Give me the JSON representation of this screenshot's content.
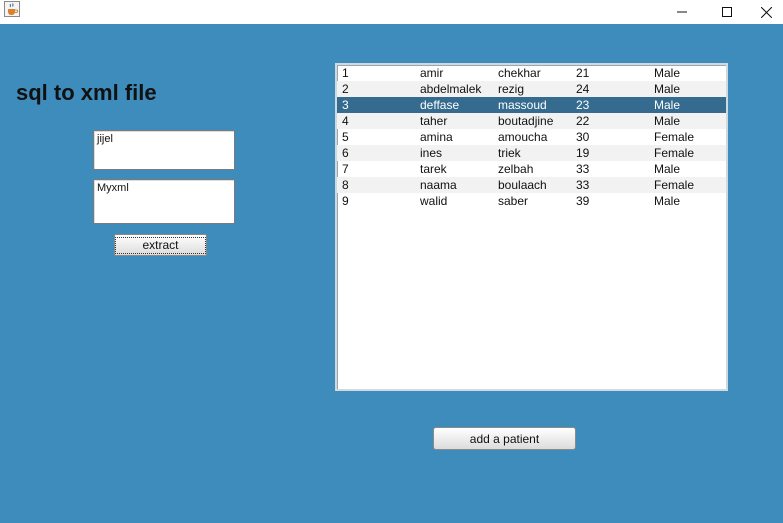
{
  "window": {
    "icon": "java-coffee-cup-icon",
    "controls": [
      "minimize-icon",
      "maximize-icon",
      "close-icon"
    ]
  },
  "heading": "sql to xml file",
  "inputs": {
    "first": "jijel",
    "second": "Myxml"
  },
  "buttons": {
    "extract": "extract",
    "add_patient": "add a patient"
  },
  "colors": {
    "background": "#3d8cbc",
    "selection": "#356b8f"
  },
  "patients": {
    "selected_index": 2,
    "rows": [
      [
        "1",
        "amir",
        "chekhar",
        "21",
        "Male"
      ],
      [
        "2",
        "abdelmalek",
        "rezig",
        "24",
        "Male"
      ],
      [
        "3",
        "deffase",
        "massoud",
        "23",
        "Male"
      ],
      [
        "4",
        "taher",
        "boutadjine",
        "22",
        "Male"
      ],
      [
        "5",
        "amina",
        "amoucha",
        "30",
        "Female"
      ],
      [
        "6",
        "ines",
        "triek",
        "19",
        "Female"
      ],
      [
        "7",
        "tarek",
        "zelbah",
        "33",
        "Male"
      ],
      [
        "8",
        "naama",
        "boulaach",
        "33",
        "Female"
      ],
      [
        "9",
        "walid",
        "saber",
        "39",
        "Male"
      ]
    ]
  }
}
